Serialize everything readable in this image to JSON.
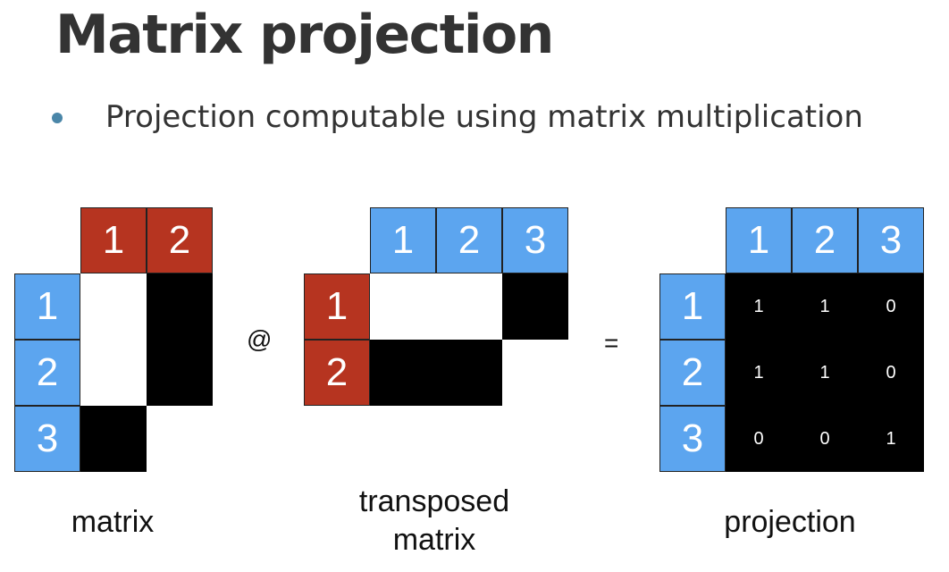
{
  "slide": {
    "title": "Matrix projection",
    "bullet": "Projection computable using matrix multiplication"
  },
  "colors": {
    "header_blue": "#5ca5ef",
    "header_red": "#b63420",
    "filled": "#000000",
    "empty": "#ffffff",
    "bullet_dot": "#4a86a8"
  },
  "matrix": {
    "caption": "matrix",
    "col_headers": [
      "1",
      "2"
    ],
    "row_headers": [
      "1",
      "2",
      "3"
    ],
    "cells": [
      [
        0,
        1
      ],
      [
        0,
        1
      ],
      [
        1,
        null
      ]
    ]
  },
  "transposed": {
    "caption_line1": "transposed",
    "caption_line2": "matrix",
    "col_headers": [
      "1",
      "2",
      "3"
    ],
    "row_headers": [
      "1",
      "2"
    ],
    "cells": [
      [
        0,
        0,
        1
      ],
      [
        1,
        1,
        null
      ]
    ]
  },
  "operators": {
    "matmul": "@",
    "equals": "="
  },
  "projection": {
    "caption": "projection",
    "col_headers": [
      "1",
      "2",
      "3"
    ],
    "row_headers": [
      "1",
      "2",
      "3"
    ],
    "values": [
      [
        "1",
        "1",
        "0"
      ],
      [
        "1",
        "1",
        "0"
      ],
      [
        "0",
        "0",
        "1"
      ]
    ]
  }
}
